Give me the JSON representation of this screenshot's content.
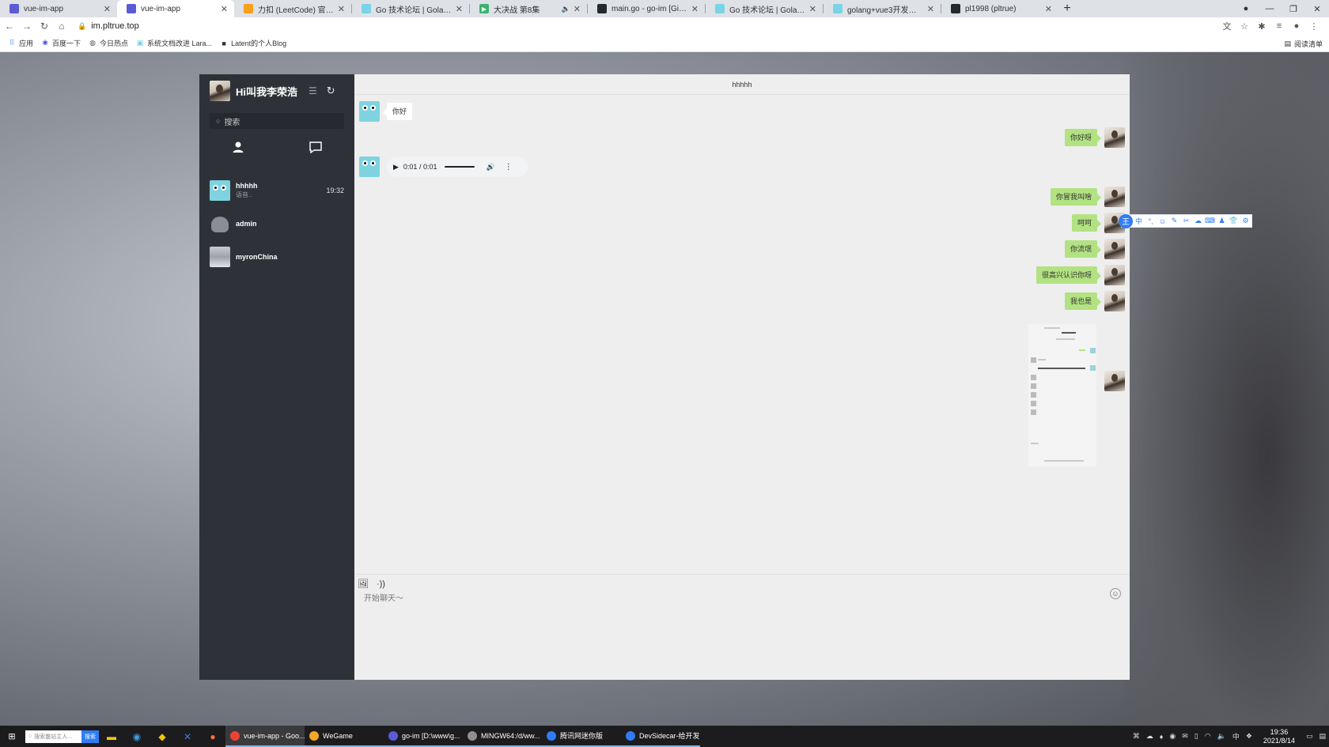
{
  "browser": {
    "tabs": [
      {
        "title": "vue-im-app",
        "favicon_color": "#5b5bd6",
        "active": false
      },
      {
        "title": "vue-im-app",
        "favicon_color": "#5b5bd6",
        "active": true
      },
      {
        "title": "力扣 (LeetCode) 官网 - 全球极",
        "favicon_color": "#f89f1b",
        "active": false
      },
      {
        "title": "Go 技术论坛 | Golang / Go 语言",
        "favicon_color": "#79d4e6",
        "active": false
      },
      {
        "title": "大决战 第8集",
        "favicon_color": "#3cb371",
        "active": false
      },
      {
        "title": "main.go - go-im [GitHub] - Vi",
        "favicon_color": "#24292e",
        "active": false
      },
      {
        "title": "Go 技术论坛 | Golang / Go 语言",
        "favicon_color": "#79d4e6",
        "active": false
      },
      {
        "title": "golang+vue3开发的一个im应用",
        "favicon_color": "#79d4e6",
        "active": false
      },
      {
        "title": "pl1998 (pltrue)",
        "favicon_color": "#24292e",
        "active": false
      }
    ],
    "url": "im.pltrue.top",
    "bookmarks": [
      {
        "label": "应用",
        "icon": "apps-grid-icon"
      },
      {
        "label": "百度一下",
        "icon": "baidu-paw-icon"
      },
      {
        "label": "今日热点",
        "icon": "globe-icon"
      },
      {
        "label": "系统文档改进 Lara...",
        "icon": "laravel-icon"
      },
      {
        "label": "Latent的个人Blog",
        "icon": "blog-icon"
      }
    ],
    "reading_list": "阅读清单"
  },
  "sidebar": {
    "user_name": "Hi叫我李荣浩",
    "search_placeholder": "搜索",
    "contacts": [
      {
        "name": "hhhhh",
        "last_message": "语音..",
        "time": "19:32",
        "avatar": "gopher"
      },
      {
        "name": "admin",
        "last_message": "",
        "time": "",
        "avatar": "elephant"
      },
      {
        "name": "myronChina",
        "last_message": "",
        "time": "",
        "avatar": "photo"
      }
    ]
  },
  "chat": {
    "title": "hhhhh",
    "audio": {
      "time": "0:01 / 0:01"
    },
    "messages": [
      {
        "side": "left",
        "type": "text",
        "text": "你好"
      },
      {
        "side": "right",
        "type": "text",
        "text": "你好呀"
      },
      {
        "side": "left",
        "type": "audio",
        "text": ""
      },
      {
        "side": "right",
        "type": "text",
        "text": "你冒我叫啥"
      },
      {
        "side": "right",
        "type": "text",
        "text": "呵呵"
      },
      {
        "side": "right",
        "type": "text",
        "text": "你流氓"
      },
      {
        "side": "right",
        "type": "text",
        "text": "很高兴认识你呀"
      },
      {
        "side": "right",
        "type": "text",
        "text": "我也是"
      }
    ],
    "input_placeholder": "开始聊天～"
  },
  "taskbar": {
    "search_placeholder": "搜索整站主人...",
    "search_button": "搜索",
    "apps": [
      {
        "label": "vue-im-app - Goo...",
        "active": true,
        "color": "#ea4335"
      },
      {
        "label": "WeGame",
        "active": false,
        "color": "#f5a623"
      },
      {
        "label": "go-im [D:\\www\\g...",
        "active": false,
        "color": "#5b5bd6"
      },
      {
        "label": "MINGW64:/d/ww...",
        "active": false,
        "color": "#8e8e93"
      },
      {
        "label": "腾讯网迷你版",
        "active": false,
        "color": "#2f7cf6"
      },
      {
        "label": "DevSidecar-给开发...",
        "active": false,
        "color": "#2f7cf6"
      }
    ],
    "time": "19:36",
    "date": "2021/8/14"
  }
}
